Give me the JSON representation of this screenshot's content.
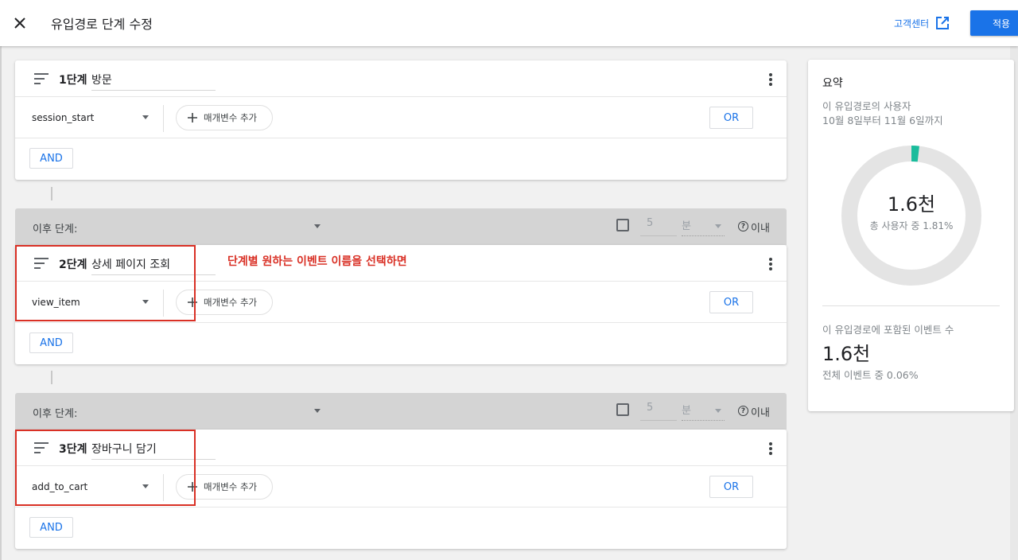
{
  "header": {
    "title": "유입경로 단계 수정",
    "help_label": "고객센터",
    "apply_label": "적용"
  },
  "steps": [
    {
      "label": "1단계",
      "name": "방문",
      "event": "session_start",
      "param_label": "매개변수 추가",
      "or_label": "OR",
      "and_label": "AND"
    },
    {
      "label": "2단계",
      "name": "상세 페이지 조회",
      "event": "view_item",
      "param_label": "매개변수 추가",
      "or_label": "OR",
      "and_label": "AND"
    },
    {
      "label": "3단계",
      "name": "장바구니 담기",
      "event": "add_to_cart",
      "param_label": "매개변수 추가",
      "or_label": "OR",
      "and_label": "AND"
    }
  ],
  "sequence": [
    {
      "label": "이후 단계:",
      "value": "5",
      "unit": "분",
      "within_label": "이내",
      "help_icon": "?"
    },
    {
      "label": "이후 단계:",
      "value": "5",
      "unit": "분",
      "within_label": "이내",
      "help_icon": "?"
    }
  ],
  "annotation": "단계별 원하는 이벤트 이름을 선택하면",
  "summary": {
    "title": "요약",
    "users_label": "이 유입경로의 사용자",
    "date_range": "10월 8일부터 11월 6일까지",
    "users_value": "1.6천",
    "users_pct_label": "총 사용자 중 1.81%",
    "users_fraction": 0.0181,
    "events_label": "이 유입경로에 포함된 이벤트 수",
    "events_value": "1.6천",
    "events_pct_label": "전체 이벤트 중 0.06%"
  },
  "colors": {
    "accent": "#1a73e8",
    "donut_fill": "#1abc9c",
    "donut_track": "#e4e4e4",
    "annotation": "#d93025"
  }
}
